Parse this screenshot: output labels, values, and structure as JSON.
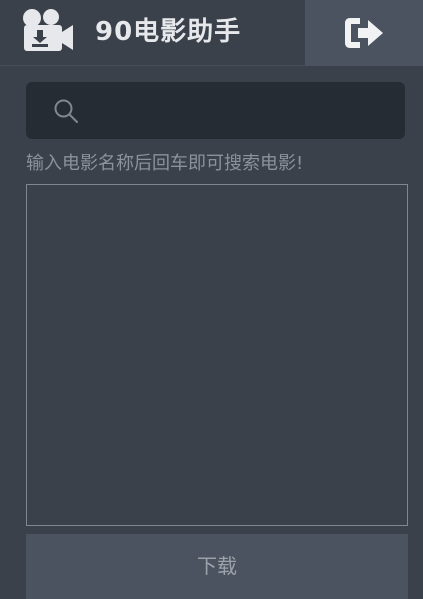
{
  "header": {
    "title": "90电影助手",
    "logo_icon": "movie-camera-download-icon",
    "exit_icon": "sign-out-icon"
  },
  "search": {
    "icon": "search-icon",
    "value": "",
    "placeholder": ""
  },
  "hint": "输入电影名称后回车即可搜索电影!",
  "results": {
    "items": []
  },
  "download_button": {
    "label": "下载"
  },
  "colors": {
    "background": "#3a414b",
    "search_background": "#262c34",
    "button_background": "#4a535f",
    "title_text": "#e6e8eb",
    "hint_text": "#8b929c"
  }
}
